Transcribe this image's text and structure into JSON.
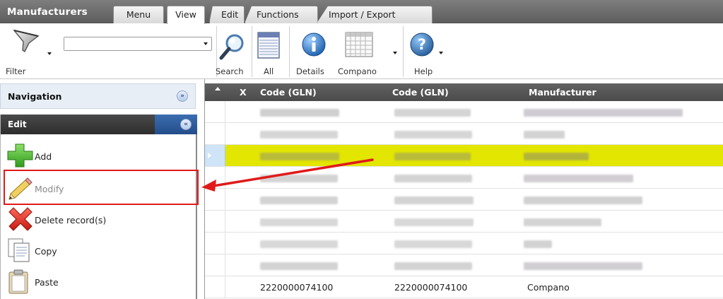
{
  "app": {
    "title": "Manufacturers"
  },
  "tabs": [
    {
      "label": "Menu"
    },
    {
      "label": "View"
    },
    {
      "label": "Edit"
    },
    {
      "label": "Functions"
    },
    {
      "label": "Import / Export"
    }
  ],
  "toolbar": {
    "filter_label": "Filter",
    "filter_value": "",
    "search_label": "Search",
    "all_label": "All",
    "details_label": "Details",
    "companion_label": "Compano",
    "help_label": "Help"
  },
  "navigation": {
    "title": "Navigation"
  },
  "edit_panel": {
    "title": "Edit",
    "actions": [
      {
        "label": "Add",
        "icon": "plus-icon",
        "enabled": true
      },
      {
        "label": "Modify",
        "icon": "pencil-icon",
        "enabled": false
      },
      {
        "label": "Delete record(s)",
        "icon": "delete-x-icon",
        "enabled": true
      },
      {
        "label": "Copy",
        "icon": "copy-icon",
        "enabled": true
      },
      {
        "label": "Paste",
        "icon": "paste-icon",
        "enabled": true
      }
    ]
  },
  "grid": {
    "columns": [
      "X",
      "Code (GLN)",
      "Code (GLN)",
      "Manufacturer"
    ],
    "selected_row_index": 2,
    "last_row": {
      "code1": "2220000074100",
      "code2": "2220000074100",
      "manufacturer": "Compano"
    }
  },
  "colors": {
    "selection": "#e2e600",
    "annotation": "#e01a1a",
    "header": "#555555"
  }
}
